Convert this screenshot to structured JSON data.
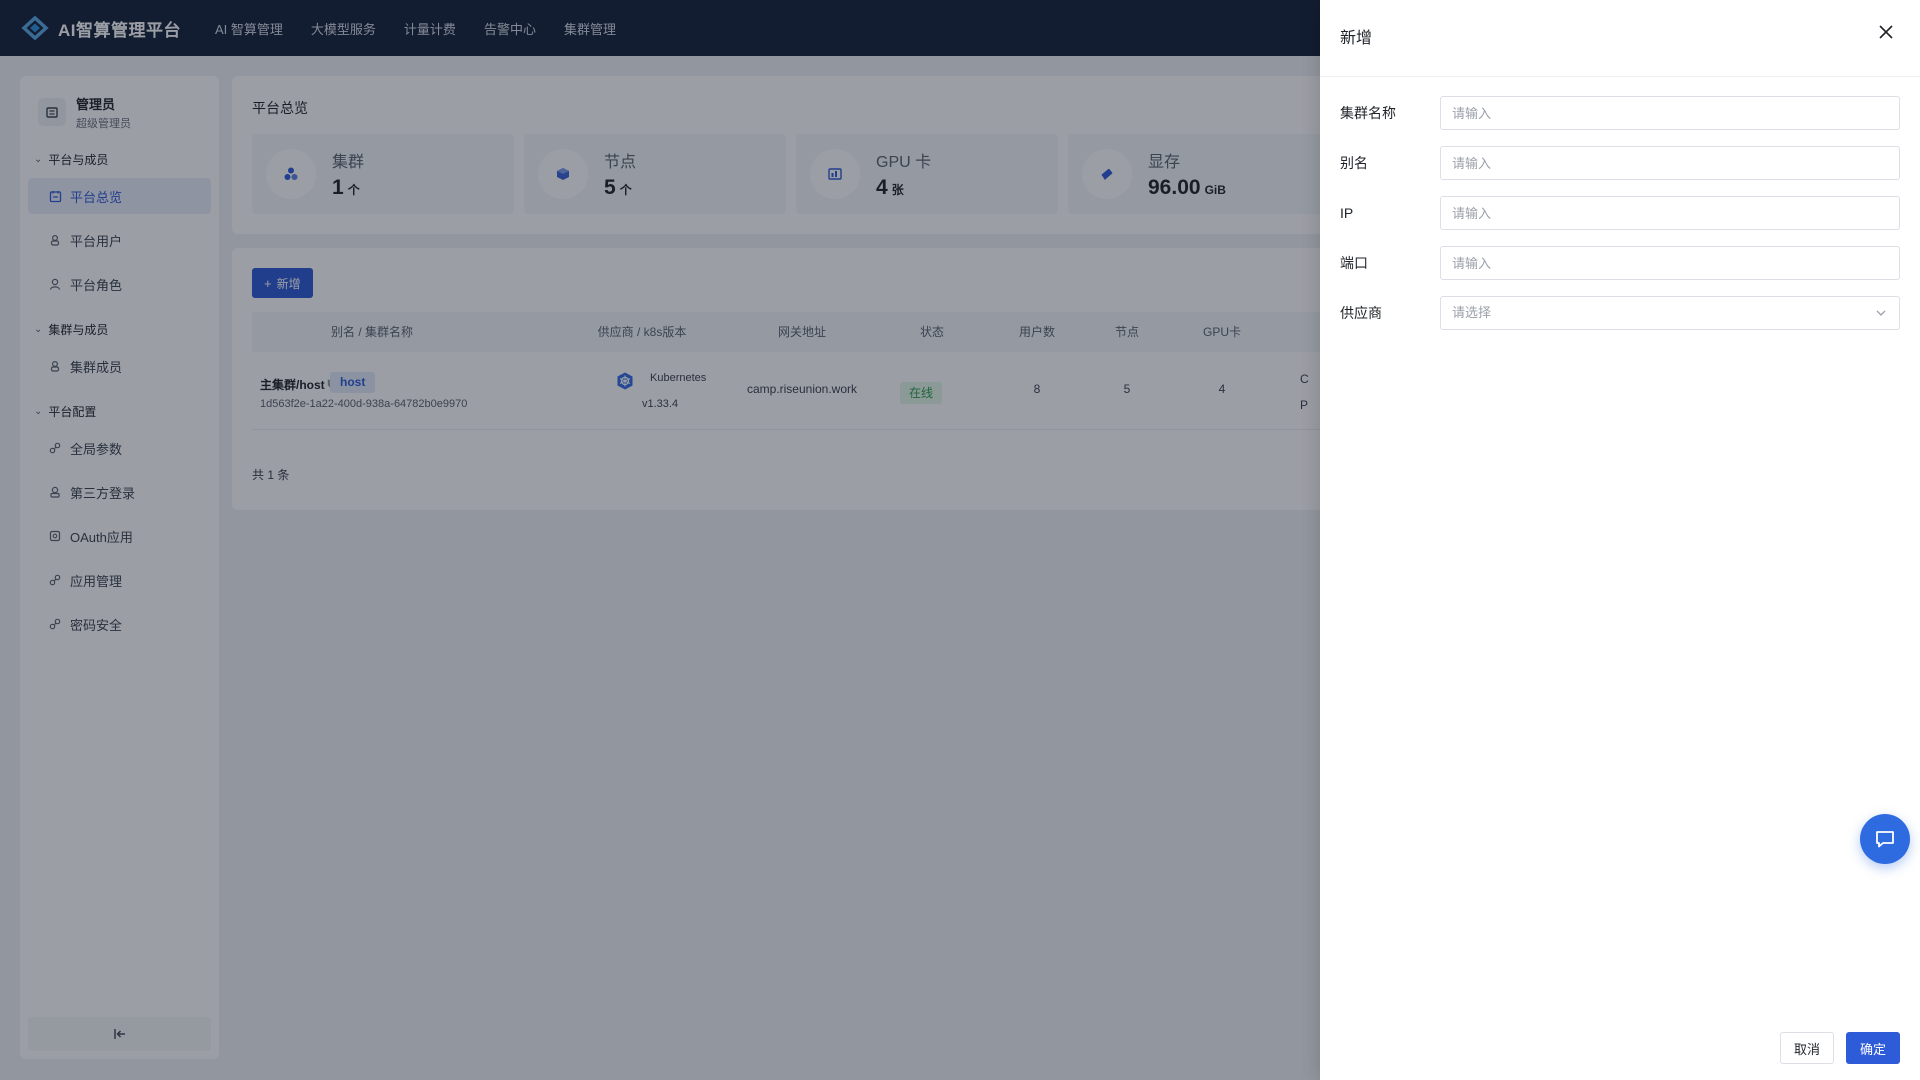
{
  "header": {
    "app_title": "AI智算管理平台",
    "nav": [
      "AI 智算管理",
      "大模型服务",
      "计量计费",
      "告警中心",
      "集群管理"
    ]
  },
  "sidebar": {
    "user": {
      "name": "管理员",
      "role": "超级管理员"
    },
    "groups": [
      {
        "title": "平台与成员",
        "items": [
          {
            "label": "平台总览",
            "icon": "dashboard-icon",
            "active": true
          },
          {
            "label": "平台用户",
            "icon": "user-icon"
          },
          {
            "label": "平台角色",
            "icon": "role-icon"
          }
        ]
      },
      {
        "title": "集群与成员",
        "items": [
          {
            "label": "集群成员",
            "icon": "user-icon"
          }
        ]
      },
      {
        "title": "平台配置",
        "items": [
          {
            "label": "全局参数",
            "icon": "link-icon"
          },
          {
            "label": "第三方登录",
            "icon": "login-icon"
          },
          {
            "label": "OAuth应用",
            "icon": "app-icon"
          },
          {
            "label": "应用管理",
            "icon": "link-icon"
          },
          {
            "label": "密码安全",
            "icon": "link-icon"
          }
        ]
      }
    ],
    "collapse_icon": "collapse-left-icon"
  },
  "overview": {
    "title": "平台总览",
    "stats": [
      {
        "label": "集群",
        "value": "1",
        "unit": "个",
        "icon": "cluster-icon"
      },
      {
        "label": "节点",
        "value": "5",
        "unit": "个",
        "icon": "node-icon"
      },
      {
        "label": "GPU 卡",
        "value": "4",
        "unit": "张",
        "icon": "gpu-icon"
      },
      {
        "label": "显存",
        "value": "96.00",
        "unit": "GiB",
        "icon": "memory-icon"
      }
    ]
  },
  "table": {
    "add_label": "新增",
    "columns": [
      "别名 / 集群名称",
      "供应商 / k8s版本",
      "网关地址",
      "状态",
      "用户数",
      "节点",
      "GPU卡"
    ],
    "rows": [
      {
        "name": "主集群/host",
        "tag": "host",
        "id": "1d563f2e-1a22-400d-938a-64782b0e9970",
        "vendor": "Kubernetes",
        "version": "v1.33.4",
        "gateway": "camp.riseunion.work",
        "status": "在线",
        "users": "8",
        "nodes": "5",
        "gpus": "4",
        "extra_top": "C",
        "extra_bottom": "P"
      }
    ],
    "total": "共 1 条"
  },
  "drawer": {
    "title": "新增",
    "fields": [
      {
        "label": "集群名称",
        "placeholder": "请输入"
      },
      {
        "label": "别名",
        "placeholder": "请输入"
      },
      {
        "label": "IP",
        "placeholder": "请输入"
      },
      {
        "label": "端口",
        "placeholder": "请输入"
      }
    ],
    "vendor": {
      "label": "供应商",
      "placeholder": "请选择"
    },
    "cancel_label": "取消",
    "ok_label": "确定"
  },
  "colors": {
    "primary": "#2e5bd8",
    "header_bg": "#16213a",
    "success": "#2e9d4c"
  }
}
